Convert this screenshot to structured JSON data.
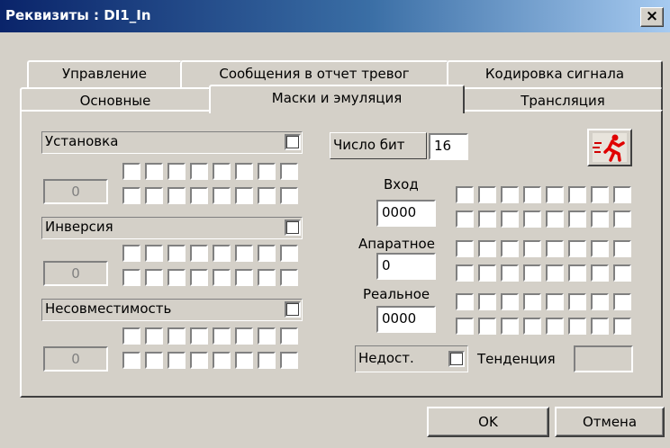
{
  "window": {
    "title": "Реквизиты : DI1_In",
    "close_label": "×"
  },
  "tabs_back": [
    {
      "label": "Управление"
    },
    {
      "label": "Сообщения в отчет тревог"
    },
    {
      "label": "Кодировка сигнала"
    }
  ],
  "tabs_front": [
    {
      "label": "Основные"
    },
    {
      "label": "Маски и эмуляция",
      "active": true
    },
    {
      "label": "Трансляция"
    }
  ],
  "masks": [
    {
      "label": "Установка",
      "value": "0",
      "checked": false
    },
    {
      "label": "Инверсия",
      "value": "0",
      "checked": false
    },
    {
      "label": "Несовместимость",
      "value": "0",
      "checked": false
    }
  ],
  "bits": {
    "label": "Число бит",
    "value": "16"
  },
  "emulation": [
    {
      "label": "Вход",
      "value": "0000"
    },
    {
      "label": "Апаратное",
      "value": "0"
    },
    {
      "label": "Реальное",
      "value": "0000"
    }
  ],
  "unavailable": {
    "label": "Недост.",
    "checked": false
  },
  "trend": {
    "label": "Тенденция",
    "value": ""
  },
  "buttons": {
    "ok": "OK",
    "cancel": "Отмена"
  },
  "icons": {
    "run": "running-man-icon"
  }
}
